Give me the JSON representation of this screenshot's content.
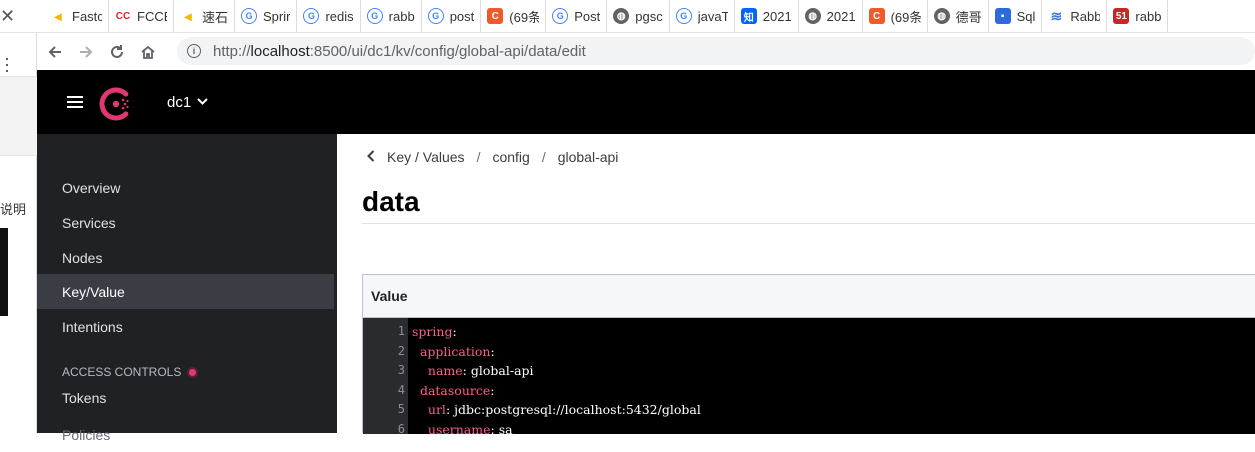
{
  "bookmarks": [
    {
      "label": "Fastc",
      "icon": "fastc-icon",
      "color": "#f5b700"
    },
    {
      "label": "FCCE",
      "icon": "cc-icon",
      "color": "#e0232b"
    },
    {
      "label": "速石",
      "icon": "sushi-icon",
      "color": "#f5b700"
    },
    {
      "label": "Sprir",
      "icon": "google-icon",
      "color": "#4285f4"
    },
    {
      "label": "redis",
      "icon": "google-icon",
      "color": "#4285f4"
    },
    {
      "label": "rabb",
      "icon": "google-icon",
      "color": "#4285f4"
    },
    {
      "label": "post",
      "icon": "google-icon",
      "color": "#4285f4"
    },
    {
      "label": "(69条",
      "icon": "csdn-icon",
      "color": "#f05a28"
    },
    {
      "label": "Post",
      "icon": "google-icon",
      "color": "#4285f4"
    },
    {
      "label": "pgsc",
      "icon": "globe-icon",
      "color": "#5f6368"
    },
    {
      "label": "javaT",
      "icon": "google-icon",
      "color": "#4285f4"
    },
    {
      "label": "2021",
      "icon": "zhihu-icon",
      "color": "#0066ff"
    },
    {
      "label": "2021",
      "icon": "globe-icon",
      "color": "#5f6368"
    },
    {
      "label": "(69条",
      "icon": "csdn-icon",
      "color": "#f05a28"
    },
    {
      "label": "德哥",
      "icon": "globe-icon",
      "color": "#5f6368"
    },
    {
      "label": "Sql",
      "icon": "bookmark-icon",
      "color": "#2d6bdc"
    },
    {
      "label": "Rabb",
      "icon": "yuque-icon",
      "color": "#3a7bd5"
    },
    {
      "label": "rabb",
      "icon": "51cto-icon",
      "color": "#c62828"
    }
  ],
  "sliver": {
    "text": "说明"
  },
  "address": {
    "url_host": "localhost",
    "url_prefix": "http://",
    "url_rest": ":8500/ui/dc1/kv/config/global-api/data/edit"
  },
  "header": {
    "datacenter": "dc1"
  },
  "sidebar": {
    "items": [
      {
        "label": "Overview"
      },
      {
        "label": "Services"
      },
      {
        "label": "Nodes"
      },
      {
        "label": "Key/Value"
      },
      {
        "label": "Intentions"
      }
    ],
    "access_title": "ACCESS CONTROLS",
    "tokens": "Tokens",
    "policies": "Policies"
  },
  "breadcrumb": {
    "items": [
      "Key / Values",
      "config",
      "global-api"
    ],
    "separator": "/"
  },
  "page_title": "data",
  "value_panel": {
    "heading": "Value",
    "lines": [
      {
        "n": "1",
        "indent": "",
        "key": "spring",
        "value": ""
      },
      {
        "n": "2",
        "indent": "  ",
        "key": "application",
        "value": ""
      },
      {
        "n": "3",
        "indent": "    ",
        "key": "name",
        "value": "global-api"
      },
      {
        "n": "4",
        "indent": "  ",
        "key": "datasource",
        "value": ""
      },
      {
        "n": "5",
        "indent": "    ",
        "key": "url",
        "value": "jdbc:postgresql://localhost:5432/global"
      },
      {
        "n": "6",
        "indent": "    ",
        "key": "username",
        "value": "sa"
      }
    ]
  },
  "colors": {
    "brand": "#e03875",
    "sidebar": "#1f2124",
    "active": "#3b3d45",
    "header": "#000000"
  }
}
